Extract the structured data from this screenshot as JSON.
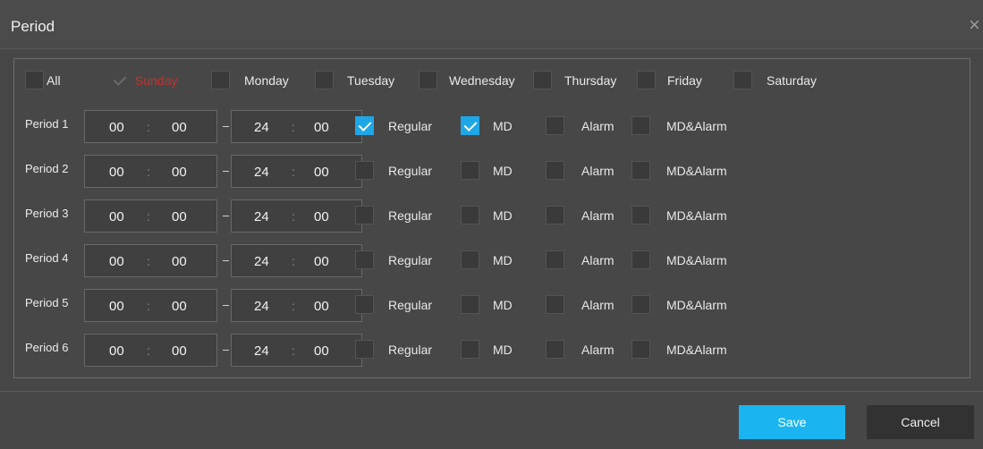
{
  "dialog": {
    "title": "Period",
    "close_glyph": "×"
  },
  "days": [
    {
      "label": "All",
      "checked": false,
      "state": "normal"
    },
    {
      "label": "Sunday",
      "checked": true,
      "state": "disabled"
    },
    {
      "label": "Monday",
      "checked": false,
      "state": "normal"
    },
    {
      "label": "Tuesday",
      "checked": false,
      "state": "normal"
    },
    {
      "label": "Wednesday",
      "checked": false,
      "state": "normal"
    },
    {
      "label": "Thursday",
      "checked": false,
      "state": "normal"
    },
    {
      "label": "Friday",
      "checked": false,
      "state": "normal"
    },
    {
      "label": "Saturday",
      "checked": false,
      "state": "normal"
    }
  ],
  "periods": [
    {
      "label": "Period 1",
      "start_h": "00",
      "start_m": "00",
      "end_h": "24",
      "end_m": "00",
      "types": [
        {
          "label": "Regular",
          "checked": true
        },
        {
          "label": "MD",
          "checked": true
        },
        {
          "label": "Alarm",
          "checked": false
        },
        {
          "label": "MD&Alarm",
          "checked": false
        }
      ]
    },
    {
      "label": "Period 2",
      "start_h": "00",
      "start_m": "00",
      "end_h": "24",
      "end_m": "00",
      "types": [
        {
          "label": "Regular",
          "checked": false
        },
        {
          "label": "MD",
          "checked": false
        },
        {
          "label": "Alarm",
          "checked": false
        },
        {
          "label": "MD&Alarm",
          "checked": false
        }
      ]
    },
    {
      "label": "Period 3",
      "start_h": "00",
      "start_m": "00",
      "end_h": "24",
      "end_m": "00",
      "types": [
        {
          "label": "Regular",
          "checked": false
        },
        {
          "label": "MD",
          "checked": false
        },
        {
          "label": "Alarm",
          "checked": false
        },
        {
          "label": "MD&Alarm",
          "checked": false
        }
      ]
    },
    {
      "label": "Period 4",
      "start_h": "00",
      "start_m": "00",
      "end_h": "24",
      "end_m": "00",
      "types": [
        {
          "label": "Regular",
          "checked": false
        },
        {
          "label": "MD",
          "checked": false
        },
        {
          "label": "Alarm",
          "checked": false
        },
        {
          "label": "MD&Alarm",
          "checked": false
        }
      ]
    },
    {
      "label": "Period 5",
      "start_h": "00",
      "start_m": "00",
      "end_h": "24",
      "end_m": "00",
      "types": [
        {
          "label": "Regular",
          "checked": false
        },
        {
          "label": "MD",
          "checked": false
        },
        {
          "label": "Alarm",
          "checked": false
        },
        {
          "label": "MD&Alarm",
          "checked": false
        }
      ]
    },
    {
      "label": "Period 6",
      "start_h": "00",
      "start_m": "00",
      "end_h": "24",
      "end_m": "00",
      "types": [
        {
          "label": "Regular",
          "checked": false
        },
        {
          "label": "MD",
          "checked": false
        },
        {
          "label": "Alarm",
          "checked": false
        },
        {
          "label": "MD&Alarm",
          "checked": false
        }
      ]
    }
  ],
  "time_separator": ":",
  "range_separator": "-",
  "footer": {
    "save_label": "Save",
    "cancel_label": "Cancel"
  },
  "colors": {
    "accent": "#1ab5f0",
    "checkbox_checked": "#1ea7e6",
    "disabled_day_label": "#c0342f",
    "background": "#474747"
  }
}
